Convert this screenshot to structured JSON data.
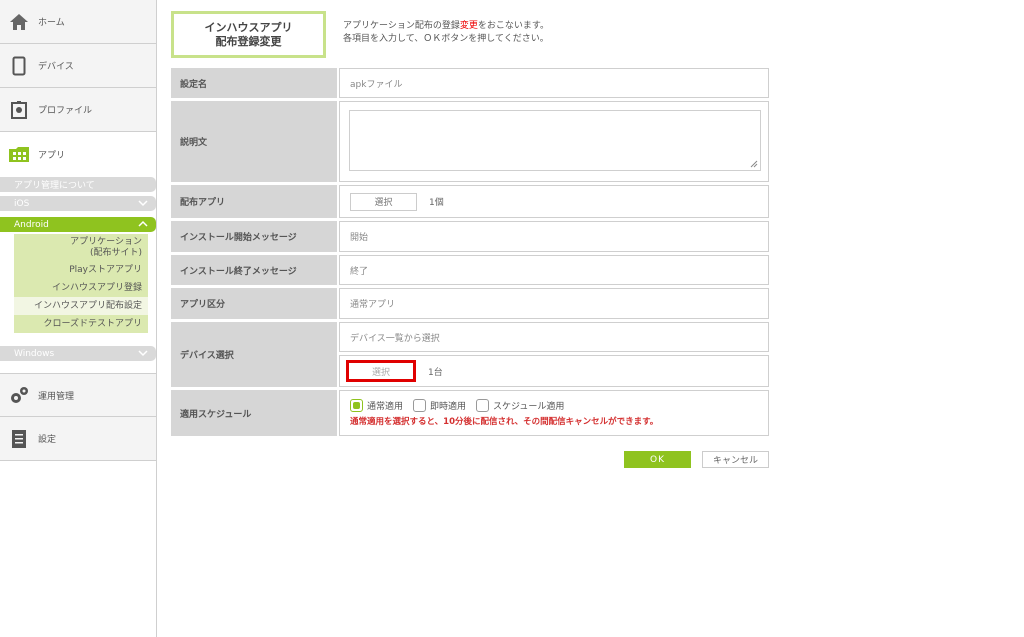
{
  "sidebar": {
    "home": "ホーム",
    "devices": "デバイス",
    "profiles": "プロファイル",
    "apps": "アプリ",
    "about": "アプリ管理について",
    "ios": "iOS",
    "android": "Android",
    "android_items": [
      "アプリケーション\n(配布サイト)",
      "Playストアアプリ",
      "インハウスアプリ登録",
      "インハウスアプリ配布設定",
      "クローズドテストアプリ"
    ],
    "windows": "Windows",
    "ops": "運用管理",
    "settings": "設定"
  },
  "header": {
    "title_line1": "インハウスアプリ",
    "title_line2": "配布登録変更",
    "desc_line1_a": "アプリケーション配布の登録",
    "desc_line1_red": "変更",
    "desc_line1_b": "をおこないます。",
    "desc_line2": "各項目を入力して、ＯＫボタンを押してください。"
  },
  "form": {
    "name_label": "設定名",
    "name_value": "apkファイル",
    "desc_label": "説明文",
    "app_label": "配布アプリ",
    "select_btn": "選択",
    "app_count": "1個",
    "start_label": "インストール開始メッセージ",
    "start_value": "開始",
    "end_label": "インストール終了メッセージ",
    "end_value": "終了",
    "type_label": "アプリ区分",
    "type_value": "通常アプリ",
    "device_label": "デバイス選択",
    "device_placeholder": "デバイス一覧から選択",
    "device_count": "1台",
    "schedule_label": "適用スケジュール",
    "schedule_options": [
      "通常適用",
      "即時適用",
      "スケジュール適用"
    ],
    "schedule_warning": "通常適用を選択すると、10分後に配信され、その間配信キャンセルができます。"
  },
  "actions": {
    "ok": "OK",
    "cancel": "キャンセル"
  },
  "colors": {
    "accent": "#8fc31f",
    "highlight": "#e00000"
  }
}
